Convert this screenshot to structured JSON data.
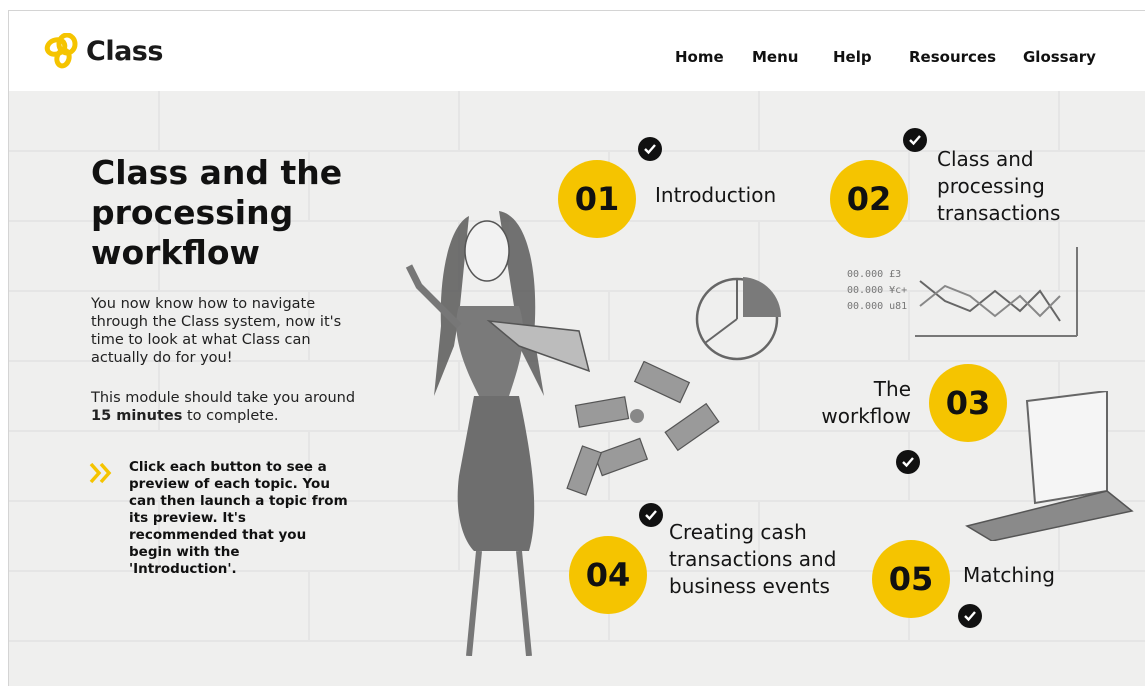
{
  "brand": {
    "name": "Class"
  },
  "nav": {
    "items": [
      "Home",
      "Menu",
      "Help",
      "Resources",
      "Glossary"
    ]
  },
  "intro": {
    "title": "Class and the processing workflow",
    "body": "You now know how to navigate through the Class system, now it's time to look at what Class can actually do for you!",
    "duration_before": "This module should take you around ",
    "duration_bold": "15 minutes",
    "duration_after": " to complete.",
    "instruction": "Click each button to see a preview of each topic. You can then launch a topic from its preview. It's recommended that you begin with the 'Introduction'."
  },
  "topics": [
    {
      "number": "01",
      "label": "Introduction",
      "completed": true
    },
    {
      "number": "02",
      "label": "Class and processing transactions",
      "completed": true
    },
    {
      "number": "03",
      "label": "The workflow",
      "completed": true
    },
    {
      "number": "04",
      "label": "Creating cash transactions and business events",
      "completed": true
    },
    {
      "number": "05",
      "label": "Matching",
      "completed": true
    }
  ],
  "illustration": {
    "ledger_lines": [
      "00.000 £3",
      "00.000 ¥c+",
      "00.000 u81"
    ]
  },
  "colors": {
    "accent": "#f5c400",
    "text": "#111111",
    "background": "#efefee",
    "check": "#111111"
  },
  "icons": {
    "logo": "class-logo-icon",
    "check": "check-icon",
    "chevrons": "double-chevron-icon"
  }
}
